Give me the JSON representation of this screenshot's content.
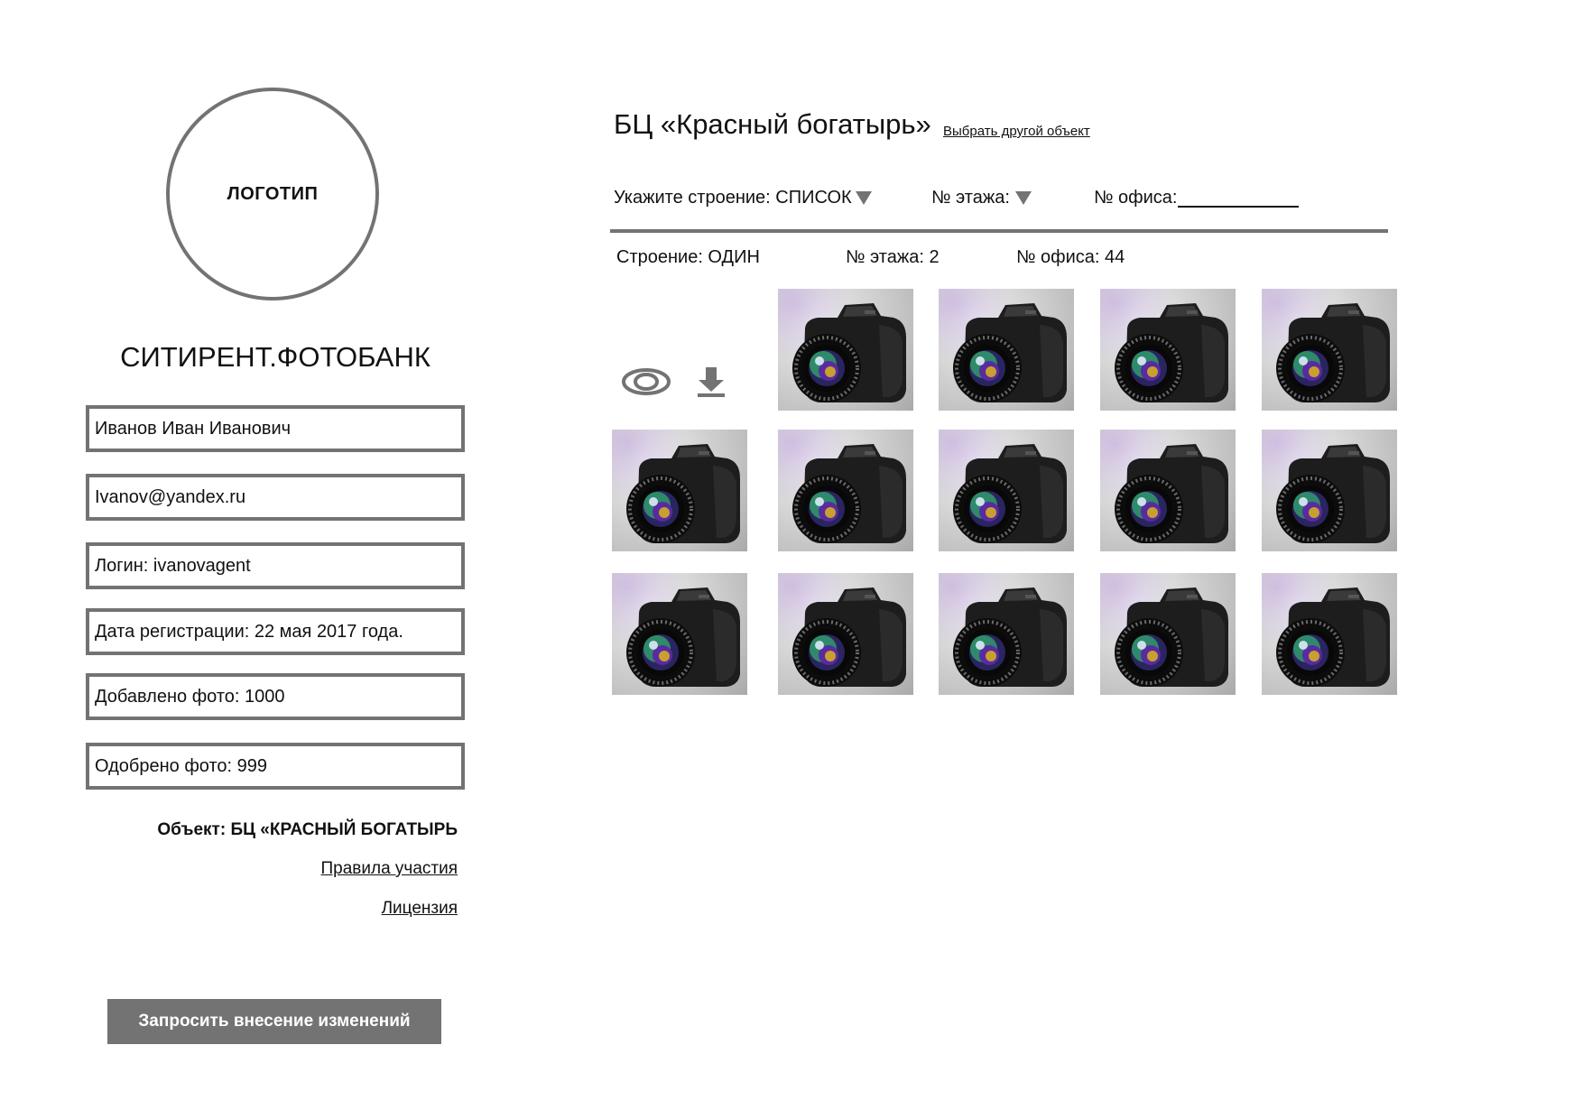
{
  "sidebar": {
    "logo_text": "ЛОГОТИП",
    "brand": "СИТИРЕНТ.ФОТОБАНК",
    "fields": [
      "Иванов Иван Иванович",
      "Ivanov@yandex.ru",
      "Логин: ivanovagent",
      "Дата регистрации: 22 мая 2017 года.",
      "Добавлено фото: 1000",
      "Одобрено фото: 999"
    ],
    "object_label": "Объект: БЦ «КРАСНЫЙ БОГАТЫРЬ",
    "rules_link": "Правила участия",
    "license_link": "Лицензия",
    "request_button": "Запросить внесение изменений"
  },
  "main": {
    "title": "БЦ «Красный богатырь»",
    "change_object_link": "Выбрать другой объект",
    "filters": {
      "building_label": "Укажите строение: СПИСОК",
      "floor_label": "№ этажа:",
      "office_label": "№ офиса:"
    },
    "selected": {
      "building": "Строение: ОДИН",
      "floor": "№ этажа: 2",
      "office": "№ офиса: 44"
    },
    "icons": {
      "view": "eye-icon",
      "download": "download-icon"
    },
    "photo_icon": "camera-icon",
    "photo_count": 14
  }
}
